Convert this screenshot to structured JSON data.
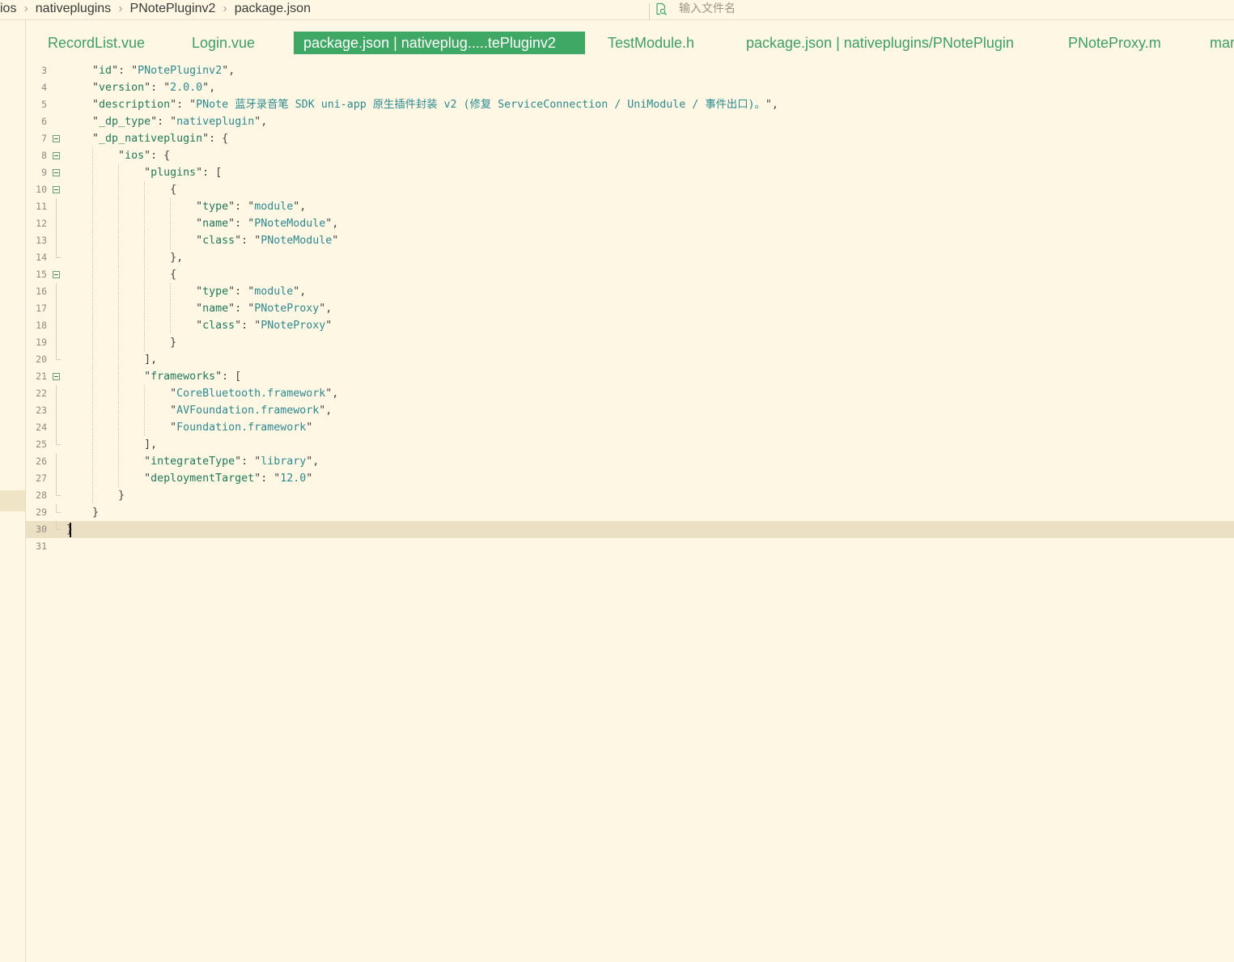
{
  "breadcrumb": [
    "ios",
    "nativeplugins",
    "PNotePluginv2",
    "package.json"
  ],
  "search": {
    "placeholder": "输入文件名"
  },
  "tabs": [
    {
      "label": "RecordList.vue",
      "active": false
    },
    {
      "label": "Login.vue",
      "active": false
    },
    {
      "label": "package.json | nativeplug.....tePluginv2",
      "active": true
    },
    {
      "label": "TestModule.h",
      "active": false
    },
    {
      "label": "package.json | nativeplugins/PNotePlugin",
      "active": false
    },
    {
      "label": "PNoteProxy.m",
      "active": false
    },
    {
      "label": "mar",
      "active": false
    }
  ],
  "editor": {
    "current_line": 30,
    "lines": [
      {
        "n": "3",
        "code": "    \"id\": \"PNotePluginv2\","
      },
      {
        "n": "4",
        "code": "    \"version\": \"2.0.0\","
      },
      {
        "n": "5",
        "code": "    \"description\": \"PNote 蓝牙录音笔 SDK uni-app 原生插件封装 v2 (修复 ServiceConnection / UniModule / 事件出口)。\","
      },
      {
        "n": "6",
        "code": "    \"_dp_type\": \"nativeplugin\","
      },
      {
        "n": "7",
        "code": "    \"_dp_nativeplugin\": {"
      },
      {
        "n": "8",
        "code": "        \"ios\": {"
      },
      {
        "n": "9",
        "code": "            \"plugins\": ["
      },
      {
        "n": "10",
        "code": "                {"
      },
      {
        "n": "11",
        "code": "                    \"type\": \"module\","
      },
      {
        "n": "12",
        "code": "                    \"name\": \"PNoteModule\","
      },
      {
        "n": "13",
        "code": "                    \"class\": \"PNoteModule\""
      },
      {
        "n": "14",
        "code": "                },"
      },
      {
        "n": "15",
        "code": "                {"
      },
      {
        "n": "16",
        "code": "                    \"type\": \"module\","
      },
      {
        "n": "17",
        "code": "                    \"name\": \"PNoteProxy\","
      },
      {
        "n": "18",
        "code": "                    \"class\": \"PNoteProxy\""
      },
      {
        "n": "19",
        "code": "                }"
      },
      {
        "n": "20",
        "code": "            ],"
      },
      {
        "n": "21",
        "code": "            \"frameworks\": ["
      },
      {
        "n": "22",
        "code": "                \"CoreBluetooth.framework\","
      },
      {
        "n": "23",
        "code": "                \"AVFoundation.framework\","
      },
      {
        "n": "24",
        "code": "                \"Foundation.framework\""
      },
      {
        "n": "25",
        "code": "            ],"
      },
      {
        "n": "26",
        "code": "            \"integrateType\": \"library\","
      },
      {
        "n": "27",
        "code": "            \"deploymentTarget\": \"12.0\""
      },
      {
        "n": "28",
        "code": "        }"
      },
      {
        "n": "29",
        "code": "    }"
      },
      {
        "n": "30",
        "code": "}"
      },
      {
        "n": "31",
        "code": ""
      }
    ]
  },
  "icons": {
    "search": "file-search-icon",
    "fold": "fold-collapse-icon"
  },
  "colors": {
    "accent": "#3ea864",
    "background": "#fdf7e4",
    "current_line": "#ebe0c4",
    "string": "#2d8a8f",
    "key": "#1f7a5a"
  }
}
